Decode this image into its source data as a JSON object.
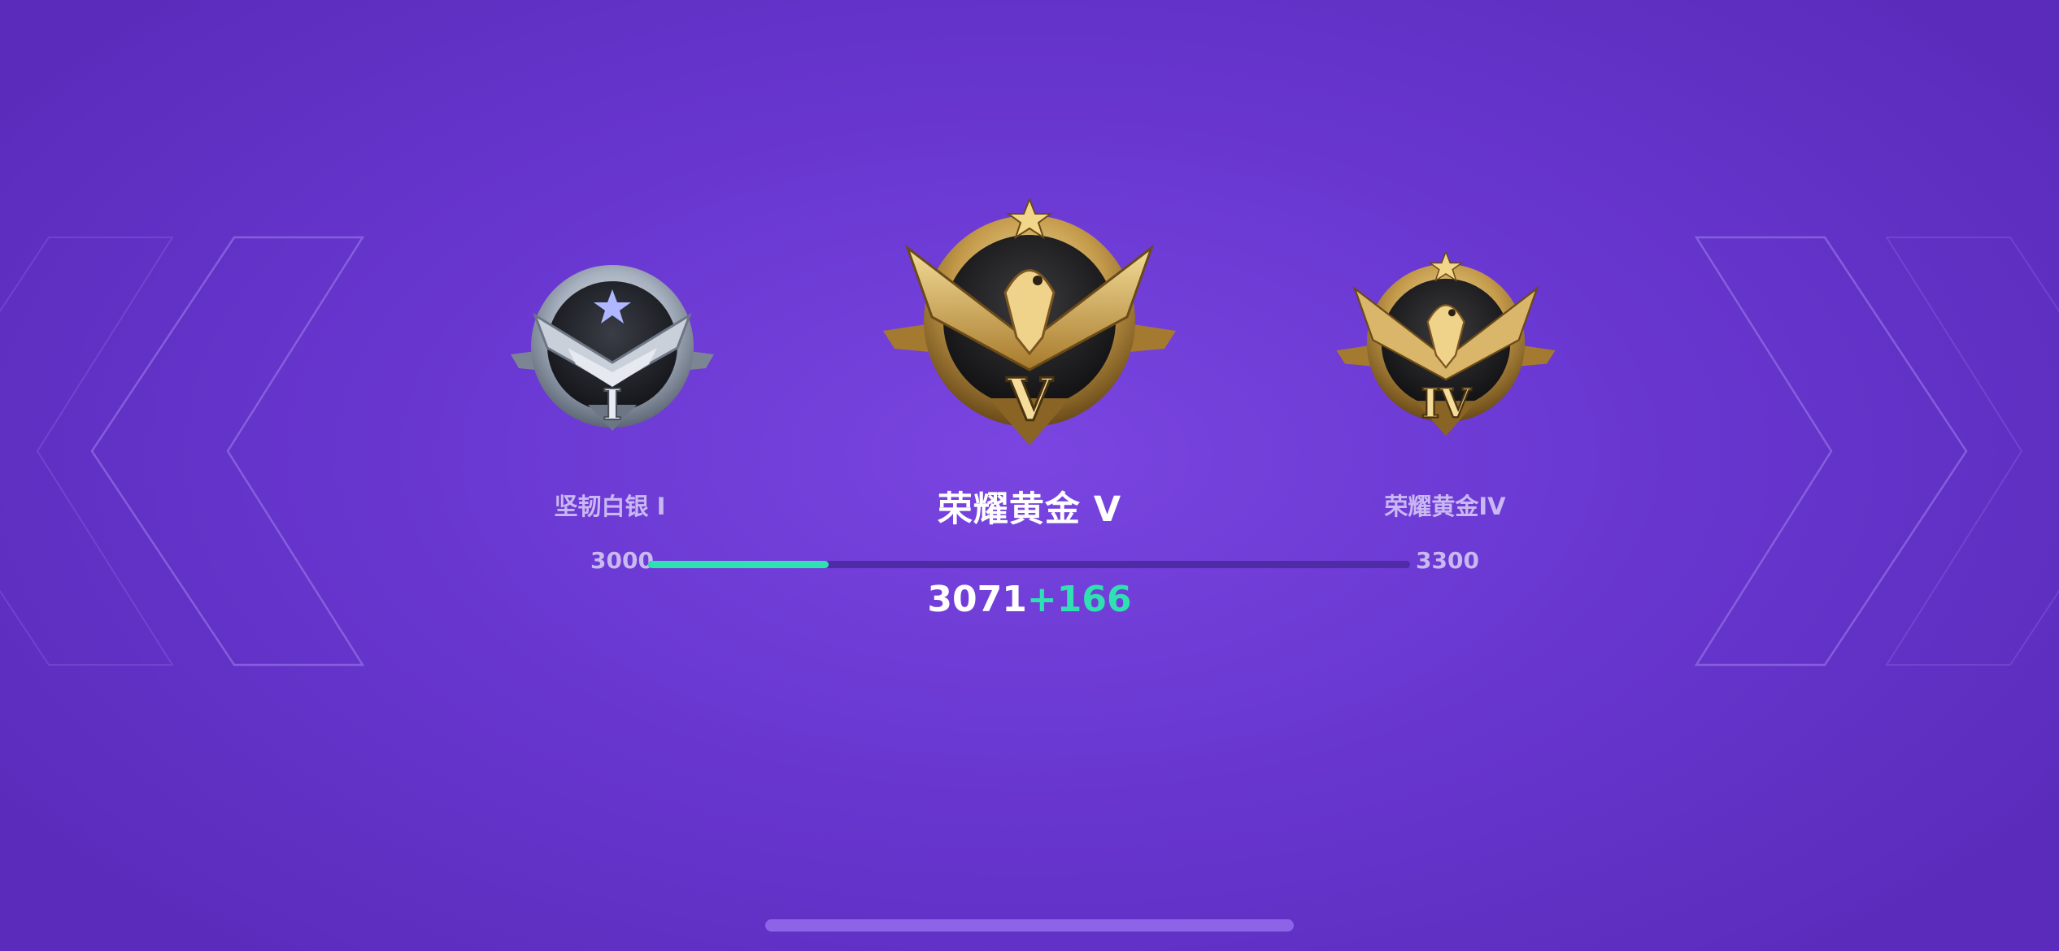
{
  "ranks": {
    "previous": {
      "name": "坚韧白银 I",
      "tier_numeral": "I"
    },
    "current": {
      "name": "荣耀黄金 V",
      "tier_numeral": "V"
    },
    "next": {
      "name": "荣耀黄金IV",
      "tier_numeral": "IV"
    }
  },
  "progress": {
    "min_label": "3000",
    "max_label": "3300",
    "fraction": 0.237,
    "score": "3071",
    "gain": "+166"
  },
  "colors": {
    "accent": "#2fe0b0",
    "gold": "#c9a95a",
    "silver": "#b8c0cc",
    "background": "#7a45e0"
  },
  "icons": {
    "left": "chevron-left-icon",
    "right": "chevron-right-icon",
    "badges": [
      "silver-rank-badge",
      "gold-rank-badge",
      "gold-rank-badge"
    ]
  }
}
